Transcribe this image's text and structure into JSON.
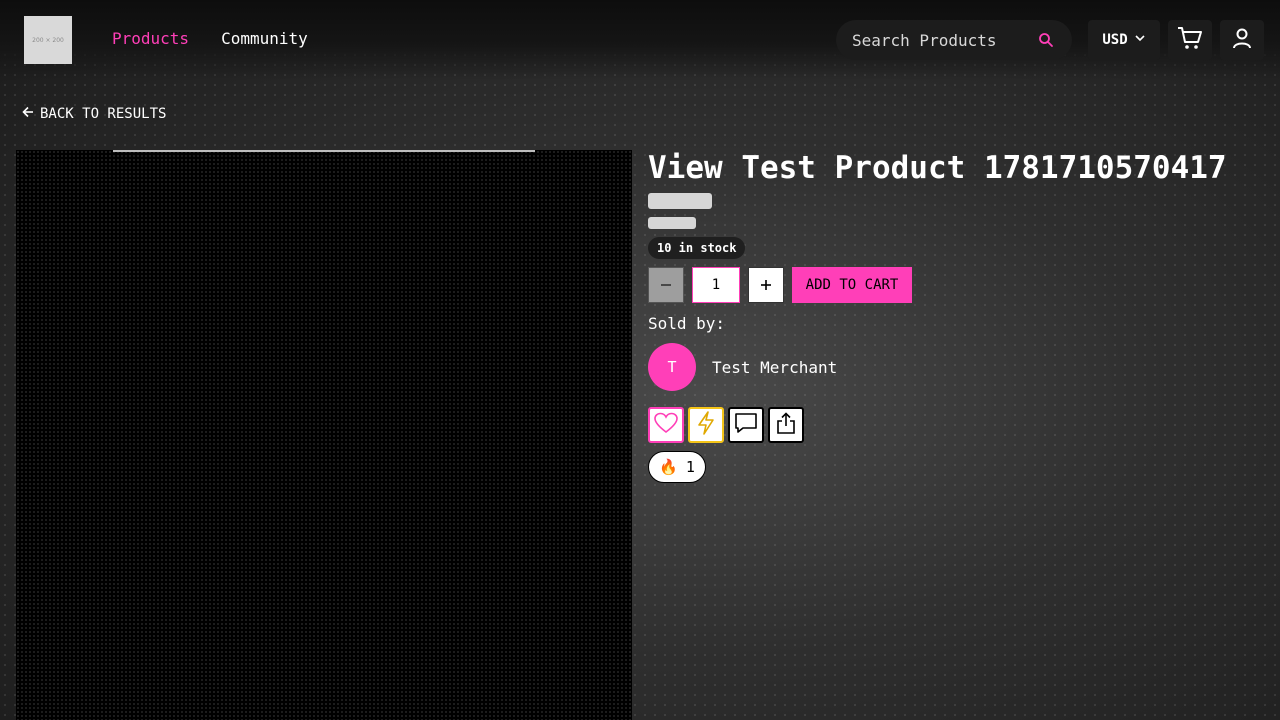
{
  "header": {
    "logo_text": "200 × 200",
    "nav": [
      {
        "label": "Products",
        "active": true
      },
      {
        "label": "Community",
        "active": false
      }
    ],
    "search_placeholder": "Search Products",
    "currency": "USD"
  },
  "back_label": "BACK TO RESULTS",
  "product": {
    "title": "View Test Product 1781710570417",
    "stock": "10 in stock",
    "quantity": "1",
    "add_to_cart": "ADD TO CART",
    "sold_by_label": "Sold by:",
    "merchant_initial": "T",
    "merchant_name": "Test Merchant"
  },
  "reaction": {
    "emoji": "🔥",
    "count": "1"
  },
  "colors": {
    "accent": "#ff3fb8",
    "yellow": "#f5c518"
  }
}
